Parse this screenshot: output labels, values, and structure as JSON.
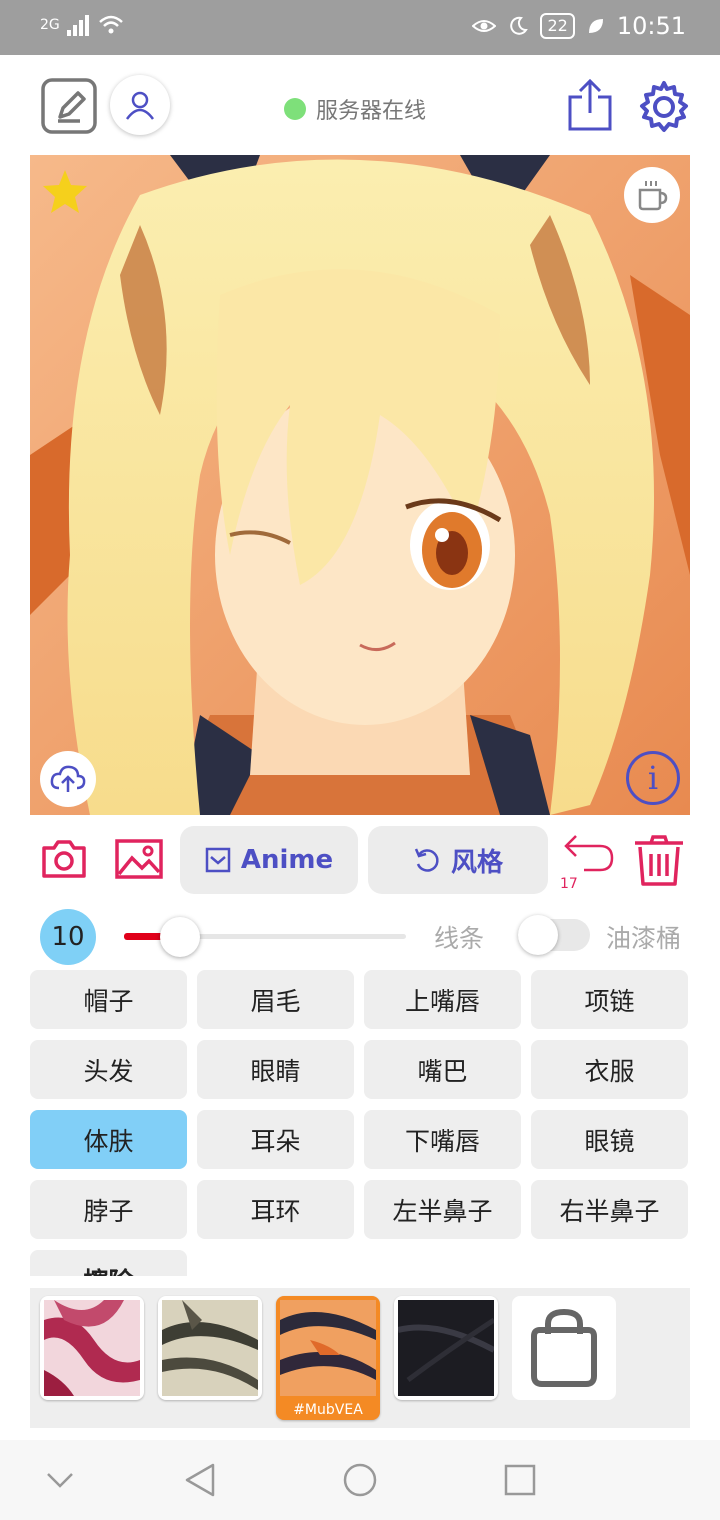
{
  "status_bar": {
    "network": "2G",
    "battery": "22",
    "time": "10:51"
  },
  "header": {
    "server_status": "服务器在线"
  },
  "canvas": {
    "info_symbol": "i"
  },
  "toolbar": {
    "anime_label": "Anime",
    "style_label": "风格",
    "undo_count": "17"
  },
  "brush": {
    "size": "10",
    "line_label": "线条",
    "bucket_label": "油漆桶",
    "slider_fraction": 0.15
  },
  "parts": [
    "帽子",
    "眉毛",
    "上嘴唇",
    "项链",
    "头发",
    "眼睛",
    "嘴巴",
    "衣服",
    "体肤",
    "耳朵",
    "下嘴唇",
    "眼镜",
    "脖子",
    "耳环",
    "左半鼻子",
    "右半鼻子",
    "擦除"
  ],
  "selected_part": "体肤",
  "swatches": {
    "selected_label": "#MubVEA"
  },
  "colors": {
    "accent": "#4d4fc4",
    "danger": "#e0245e",
    "chip_active": "#81cff7",
    "swatch_selected": "#f48a24"
  }
}
